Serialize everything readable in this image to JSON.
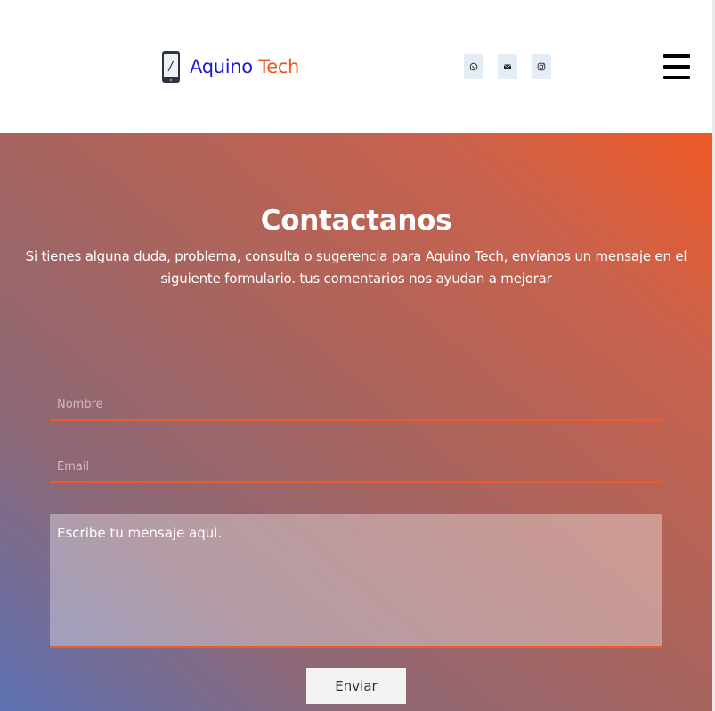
{
  "header": {
    "logo": {
      "word1": "Aquino",
      "word2": "Tech",
      "icon": "smartphone-icon"
    },
    "social": [
      {
        "name": "whatsapp",
        "icon": "whatsapp-icon"
      },
      {
        "name": "email",
        "icon": "envelope-icon"
      },
      {
        "name": "instagram",
        "icon": "instagram-icon"
      }
    ],
    "menu_icon": "hamburger-menu-icon"
  },
  "contact": {
    "title": "Contactanos",
    "description": "Si tienes alguna duda, problema, consulta o sugerencia para Aquino Tech, envianos un mensaje en el siguiente formulario. tus comentarios nos ayudan a mejorar",
    "name_placeholder": "Nombre",
    "email_placeholder": "Email",
    "message_placeholder": "Escribe tu mensaje aqui.",
    "submit_label": "Enviar"
  },
  "colors": {
    "brand_blue": "#1a1ad6",
    "brand_orange": "#e65a1e",
    "gradient_start": "#ef5a26",
    "gradient_end": "#5c70b3",
    "field_underline": "#ee5a2a"
  }
}
